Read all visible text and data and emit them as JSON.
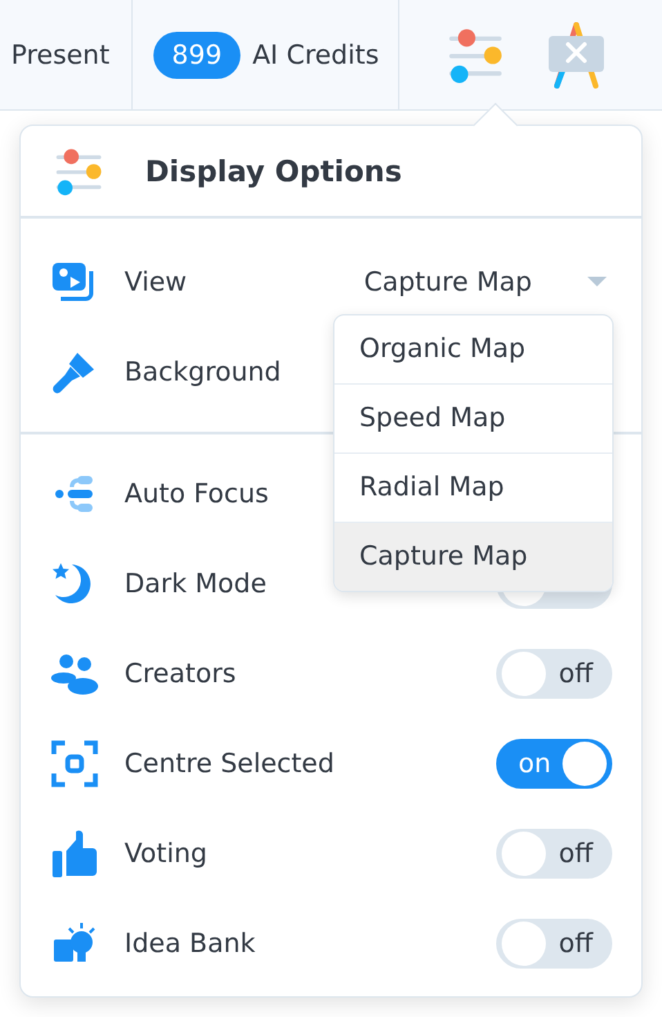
{
  "toolbar": {
    "present_label": "Present",
    "credits_count": "899",
    "credits_label": "AI Credits"
  },
  "panel": {
    "title": "Display Options",
    "sections": [
      [
        {
          "kind": "select",
          "label": "View",
          "value": "Capture Map"
        },
        {
          "kind": "plain",
          "label": "Background"
        }
      ],
      [
        {
          "kind": "plain",
          "label": "Auto Focus"
        },
        {
          "kind": "toggle",
          "label": "Dark Mode",
          "on": false
        },
        {
          "kind": "toggle",
          "label": "Creators",
          "on": false,
          "state_label": "off"
        },
        {
          "kind": "toggle",
          "label": "Centre Selected",
          "on": true,
          "state_label": "on"
        },
        {
          "kind": "toggle",
          "label": "Voting",
          "on": false,
          "state_label": "off"
        },
        {
          "kind": "toggle",
          "label": "Idea Bank",
          "on": false,
          "state_label": "off"
        }
      ]
    ],
    "dropdown": [
      {
        "label": "Organic Map",
        "selected": false
      },
      {
        "label": "Speed Map",
        "selected": false
      },
      {
        "label": "Radial Map",
        "selected": false
      },
      {
        "label": "Capture Map",
        "selected": true
      }
    ]
  }
}
